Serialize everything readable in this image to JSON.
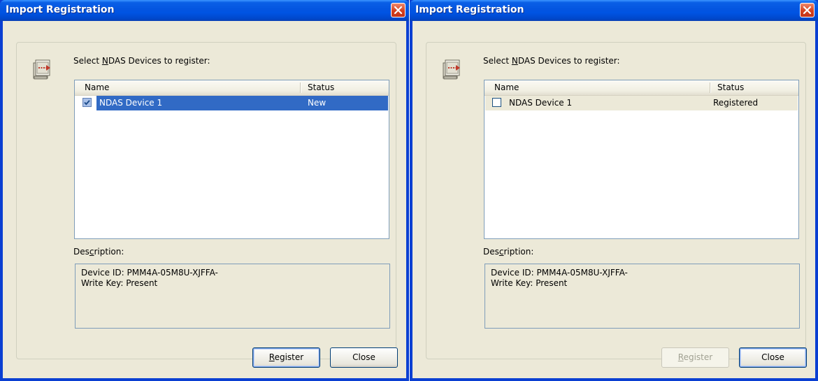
{
  "dialogs": [
    {
      "title": "Import Registration",
      "prompt": "Select NDAS Devices to register:",
      "columns": [
        "Name",
        "Status"
      ],
      "rows": [
        {
          "name": "NDAS Device 1",
          "status": "New",
          "checked": true,
          "selected": true
        }
      ],
      "description_label": "Description:",
      "description_lines": [
        "Device ID: PMM4A-05M8U-XJFFA-",
        "Write Key: Present"
      ],
      "register_label": "Register",
      "register_enabled": true,
      "close_label": "Close"
    },
    {
      "title": "Import Registration",
      "prompt": "Select NDAS Devices to register:",
      "columns": [
        "Name",
        "Status"
      ],
      "rows": [
        {
          "name": "NDAS Device 1",
          "status": "Registered",
          "checked": false,
          "selected": false
        }
      ],
      "description_label": "Description:",
      "description_lines": [
        "Device ID: PMM4A-05M8U-XJFFA-",
        "Write Key: Present"
      ],
      "register_label": "Register",
      "register_enabled": false,
      "close_label": "Close"
    }
  ],
  "colors": {
    "title_bar": "#0054e3",
    "client_bg": "#ece9d8",
    "selection": "#316ac5",
    "close_button": "#d5401d"
  },
  "icons": {
    "window_close": "close-icon",
    "import": "import-device-icon",
    "checkbox_checked": "checkmark-icon"
  }
}
